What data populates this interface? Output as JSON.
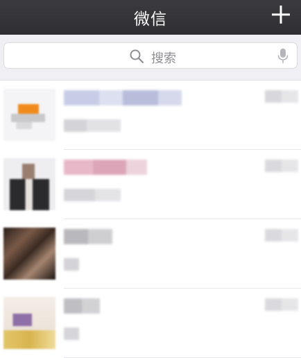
{
  "nav": {
    "title": "微信",
    "add_icon": "plus-icon"
  },
  "search": {
    "placeholder": "搜索",
    "icon": "search-icon",
    "voice_icon": "microphone-icon"
  },
  "colors": {
    "nav_bg": "#2f2f33",
    "search_bg": "#efeff4",
    "placeholder": "#8e8e93"
  },
  "chats": [
    {
      "name_visible": false,
      "preview_visible": false,
      "time_visible": false
    },
    {
      "name_visible": false,
      "preview_visible": false,
      "time_visible": false
    },
    {
      "name_visible": false,
      "preview_visible": false,
      "time_visible": false
    },
    {
      "name_visible": false,
      "preview_visible": false,
      "time_visible": false
    }
  ]
}
